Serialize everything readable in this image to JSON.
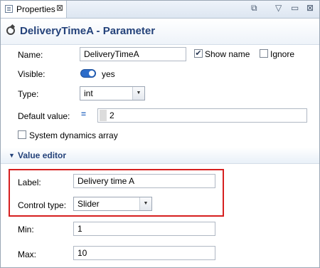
{
  "tab": {
    "title": "Properties",
    "close": "⊠"
  },
  "toolbar": {
    "new_window": "⧉",
    "minimize": "▽",
    "maximize": "▭",
    "close": "⊠"
  },
  "header": {
    "title": "DeliveryTimeA - Parameter"
  },
  "form": {
    "name_label": "Name:",
    "name_value": "DeliveryTimeA",
    "show_name_label": "Show name",
    "show_name_checked": "✔",
    "ignore_label": "Ignore",
    "visible_label": "Visible:",
    "visible_value": "yes",
    "type_label": "Type:",
    "type_value": "int",
    "default_label": "Default value:",
    "default_icon": "=",
    "default_value": "2",
    "sd_array_label": "System dynamics array"
  },
  "value_editor": {
    "title": "Value editor",
    "arrow": "▼",
    "label_label": "Label:",
    "label_value": "Delivery time A",
    "control_type_label": "Control type:",
    "control_type_value": "Slider",
    "min_label": "Min:",
    "min_value": "1",
    "max_label": "Max:",
    "max_value": "10"
  },
  "dropdown_arrow": "▼",
  "colors": {
    "accent": "#24427a",
    "highlight": "#d62020",
    "toggle": "#2c6cc9"
  }
}
